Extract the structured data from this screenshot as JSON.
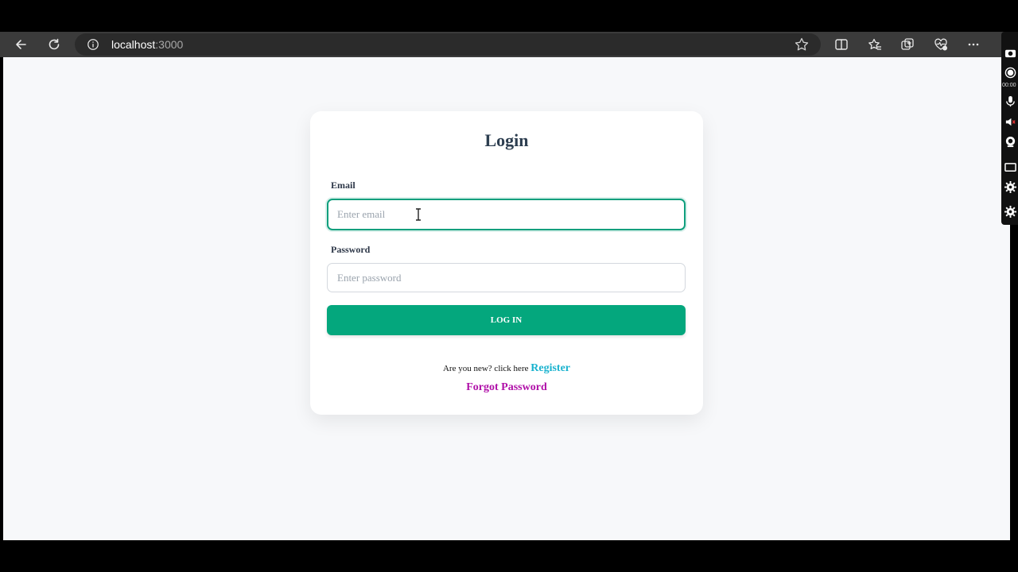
{
  "browser": {
    "address_host": "localhost",
    "address_port": ":3000"
  },
  "recorder": {
    "timer": "00:00"
  },
  "login_form": {
    "title": "Login",
    "email_label": "Email",
    "email_placeholder": "Enter email",
    "email_value": "",
    "password_label": "Password",
    "password_placeholder": "Enter password",
    "password_value": "",
    "submit_label": "LOG IN",
    "register_prompt": "Are you new? click here",
    "register_link": "Register",
    "forgot_link": "Forgot Password"
  },
  "colors": {
    "accent": "#04a77d",
    "register_link": "#1bb3cf",
    "forgot_link": "#b010a8",
    "page_bg": "#f7f8fa",
    "title": "#2d3e50"
  },
  "icons": {
    "back": "back-arrow-icon",
    "reload": "reload-icon",
    "site_info": "info-icon",
    "favorite": "star-icon",
    "split_screen": "split-screen-icon",
    "favorites": "favorites-icon",
    "collections": "collections-icon",
    "browser_essentials": "heart-pulse-icon",
    "more": "more-icon"
  }
}
